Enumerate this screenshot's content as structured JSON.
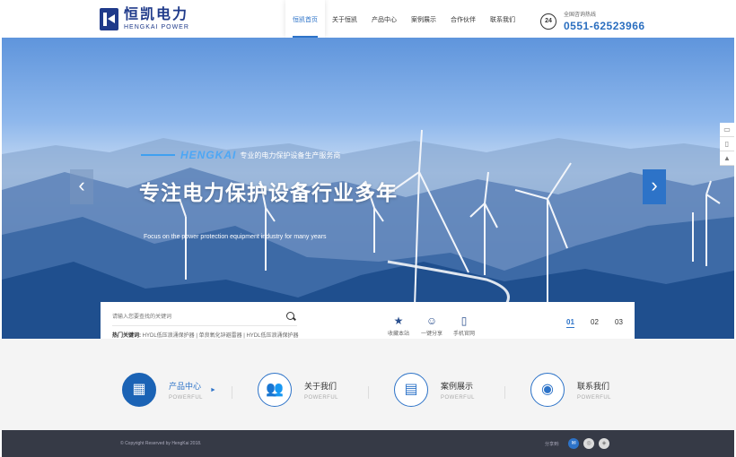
{
  "header": {
    "logo_cn": "恒凯电力",
    "logo_en": "HENGKAI POWER",
    "nav": [
      "恒凯首页",
      "关于恒凯",
      "产品中心",
      "案例展示",
      "合作伙伴",
      "联系我们"
    ],
    "hotline_label": "全国咨询热线",
    "hotline_number": "0551-62523966",
    "phone_badge": "24"
  },
  "banner": {
    "brand": "HENGKAI",
    "tagline": "专业的电力保护设备生产服务商",
    "title": "专注电力保护设备行业多年",
    "subtitle_en": "Focus on the power protection equipment industry for many years",
    "prev_arrow": "‹",
    "next_arrow": "›"
  },
  "side_tools": [
    "▭",
    "▯",
    "▲"
  ],
  "search": {
    "placeholder": "请输入您要查找的关键词",
    "hot_label": "热门关键词:",
    "hot_keywords": "HYDL低压浪涌保护器 | 单良氧化锌避雷器 | HYDL低压浪涌保护器"
  },
  "quick_links": [
    {
      "icon": "★",
      "label": "收藏本站"
    },
    {
      "icon": "☺",
      "label": "一键分享"
    },
    {
      "icon": "▯",
      "label": "手机官网"
    }
  ],
  "pager": [
    "01",
    "02",
    "03"
  ],
  "services": [
    {
      "icon": "▦",
      "title": "产品中心",
      "en": "POWERFUL",
      "arrow": "►"
    },
    {
      "icon": "👥",
      "title": "关于我们",
      "en": "POWERFUL"
    },
    {
      "icon": "▤",
      "title": "案例展示",
      "en": "POWERFUL"
    },
    {
      "icon": "◉",
      "title": "联系我们",
      "en": "POWERFUL"
    }
  ],
  "footer": {
    "copyright": "© Copyright Reserved by HengKai 2018.",
    "share_label": "分享到:",
    "share_icons": [
      "✉",
      "◎",
      "◈"
    ]
  },
  "colors": {
    "accent": "#2d73c8",
    "footer_bg": "#363a46",
    "logo": "#1f3a8a"
  }
}
